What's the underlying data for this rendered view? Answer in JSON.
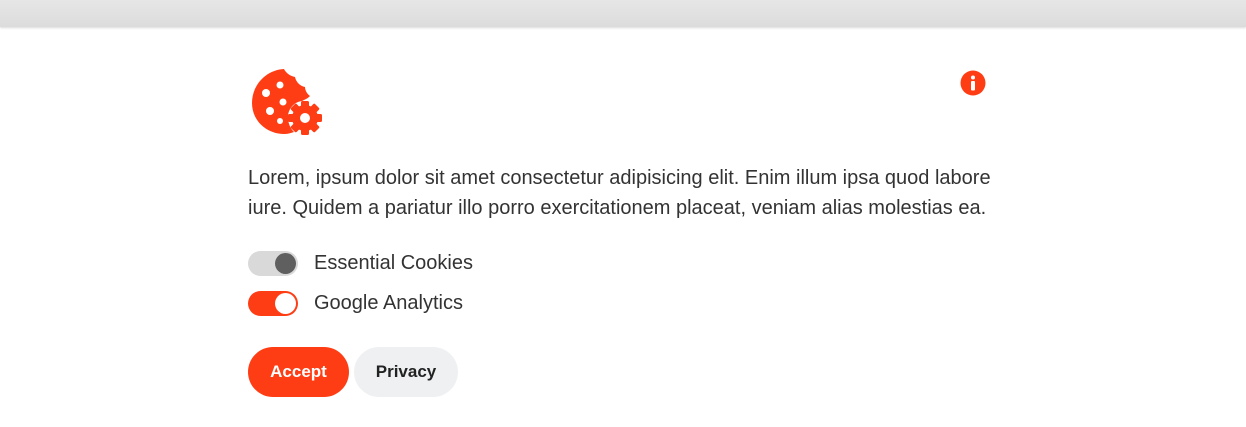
{
  "colors": {
    "accent": "#ff3d14",
    "toggle_off_track": "#d9d9d9",
    "toggle_off_knob": "#5f5f5f",
    "secondary_button": "#eef0f2",
    "text": "#333333"
  },
  "icons": {
    "logo": "cookie-gear-icon",
    "info": "info-icon"
  },
  "banner": {
    "text": "Lorem, ipsum dolor sit amet consectetur adipisicing elit. Enim illum ipsa quod labore iure. Quidem a pariatur illo porro exercitationem placeat, veniam alias molestias ea.",
    "toggles": [
      {
        "label": "Essential Cookies",
        "state": "disabled-on"
      },
      {
        "label": "Google Analytics",
        "state": "on"
      }
    ],
    "accept_label": "Accept",
    "privacy_label": "Privacy"
  }
}
